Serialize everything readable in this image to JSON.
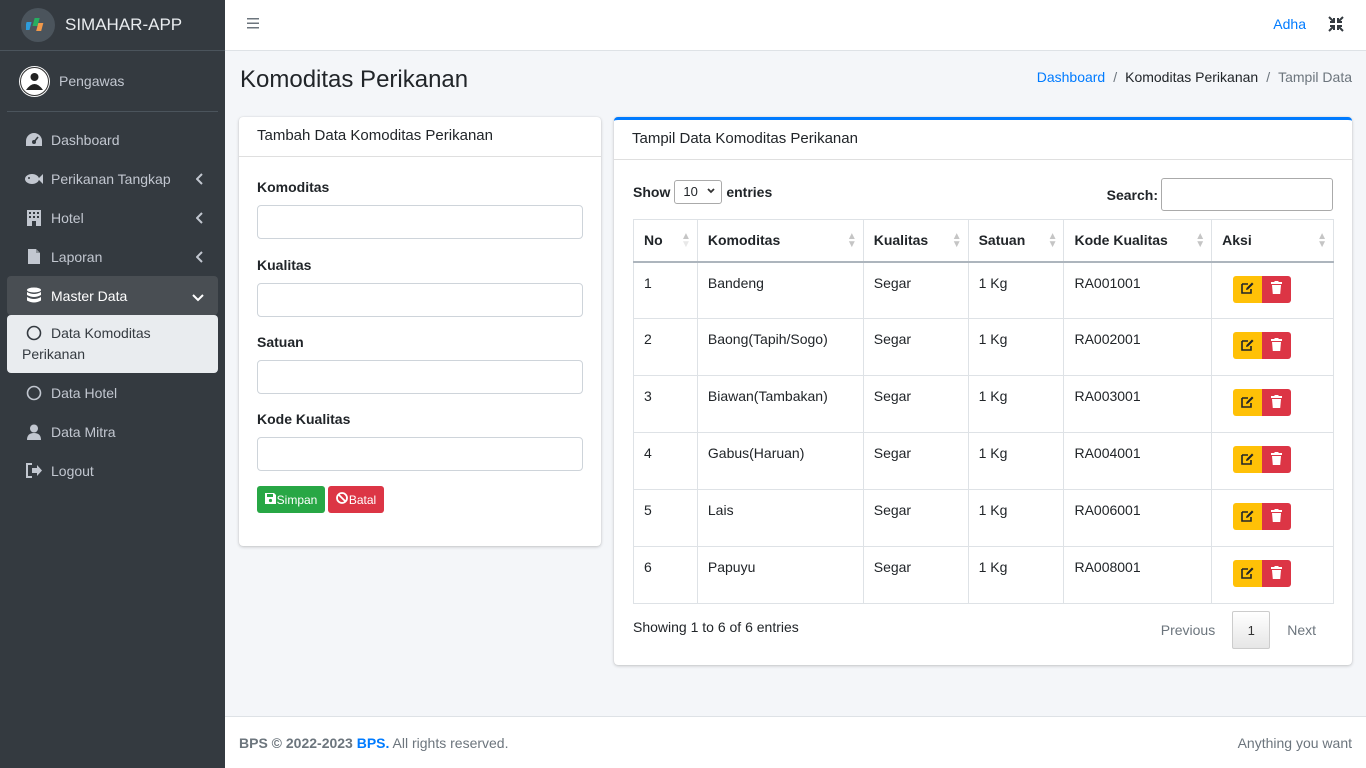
{
  "app": {
    "title": "SIMAHAR-APP"
  },
  "user_panel": {
    "name": "Pengawas"
  },
  "sidebar": {
    "items": [
      {
        "label": "Dashboard"
      },
      {
        "label": "Perikanan Tangkap"
      },
      {
        "label": "Hotel"
      },
      {
        "label": "Laporan"
      },
      {
        "label": "Master Data"
      }
    ],
    "sub_active": "Data Komoditas Perikanan",
    "sub_items": [
      {
        "label": "Data Hotel"
      },
      {
        "label": "Data Mitra"
      },
      {
        "label": "Logout"
      }
    ]
  },
  "topbar": {
    "user": "Adha"
  },
  "page": {
    "title": "Komoditas Perikanan",
    "breadcrumb": {
      "home": "Dashboard",
      "sep": "/",
      "current": "Komoditas Perikanan",
      "last": "Tampil Data"
    }
  },
  "form": {
    "header": "Tambah Data Komoditas Perikanan",
    "fields": [
      {
        "label": "Komoditas",
        "value": ""
      },
      {
        "label": "Kualitas",
        "value": ""
      },
      {
        "label": "Satuan",
        "value": ""
      },
      {
        "label": "Kode Kualitas",
        "value": ""
      }
    ],
    "save_label": "Simpan",
    "cancel_label": "Batal"
  },
  "table_card": {
    "header": "Tampil Data Komoditas Perikanan",
    "show_label": "Show",
    "page_size": "10",
    "entries_label": "entries",
    "search_label": "Search:",
    "columns": [
      "No",
      "Komoditas",
      "Kualitas",
      "Satuan",
      "Kode Kualitas",
      "Aksi"
    ],
    "rows": [
      [
        "1",
        "Bandeng",
        "Segar",
        "1 Kg",
        "RA001001"
      ],
      [
        "2",
        "Baong(Tapih/Sogo)",
        "Segar",
        "1 Kg",
        "RA002001"
      ],
      [
        "3",
        "Biawan(Tambakan)",
        "Segar",
        "1 Kg",
        "RA003001"
      ],
      [
        "4",
        "Gabus(Haruan)",
        "Segar",
        "1 Kg",
        "RA004001"
      ],
      [
        "5",
        "Lais",
        "Segar",
        "1 Kg",
        "RA006001"
      ],
      [
        "6",
        "Papuyu",
        "Segar",
        "1 Kg",
        "RA008001"
      ]
    ],
    "info": "Showing 1 to 6 of 6 entries",
    "pager": {
      "prev": "Previous",
      "current": "1",
      "next": "Next"
    }
  },
  "footer": {
    "copyright": "BPS © 2022-2023",
    "org": "BPS.",
    "rights": "All rights reserved.",
    "right_text": "Anything you want"
  }
}
